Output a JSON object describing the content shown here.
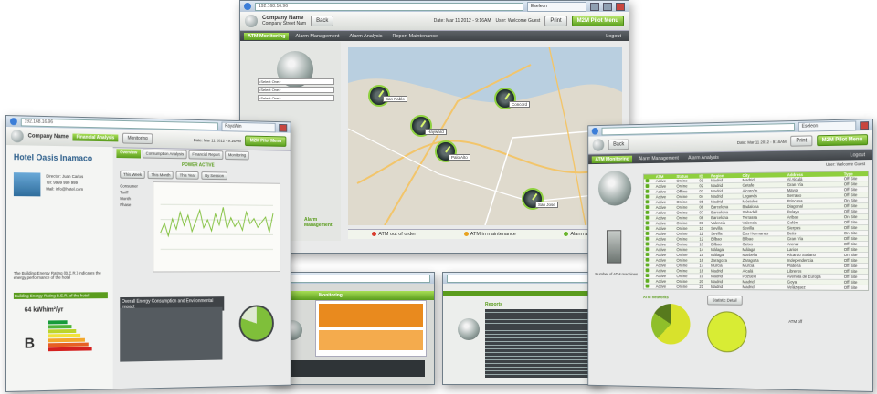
{
  "main_window": {
    "url": "192.168.16.96",
    "tab": "Eseleon",
    "brand_name": "Company Name",
    "brand_sub": "Company Street Nam",
    "back_label": "Back",
    "print_label": "Print",
    "pilot_label": "M2M Pilot Menu",
    "datetime": "Date: Mar 11 2012 - 9:16AM",
    "user": "User: Welcome Guest",
    "nav": [
      "ATM Monitoring",
      "Alarm Management",
      "Alarm Analysis",
      "Report Maintenance"
    ],
    "logout_label": "Logout",
    "selects": [
      "<Select One>",
      "<Select One>",
      "<Select One>"
    ],
    "side_title": "Alarm Management",
    "pins": [
      "San Pablo",
      "Concord",
      "Hayward",
      "Palo Alto",
      "San Jose"
    ],
    "legend": [
      {
        "label": "ATM out of order",
        "color": "#d93c2c"
      },
      {
        "label": "ATM in maintenance",
        "color": "#e8a21e"
      },
      {
        "label": "Alarm active",
        "color": "#6ab52b"
      }
    ]
  },
  "left_window": {
    "url": "192.168.16.96",
    "tab": "PayaWin",
    "brand_name": "Company Name",
    "date": "Date: Mar 11 2012 - 9:16AM",
    "user": "User: Welcome Guest",
    "nav": [
      "Financial Analysis",
      "Monitoring"
    ],
    "pilot_label": "M2M Pilot Menu",
    "hotel": "Hotel Oasis Inamaco",
    "tabs": [
      "Overview",
      "Consumption Analysis",
      "Financial Report",
      "Monitoring"
    ],
    "chart_title": "POWER ACTIVE",
    "periods": [
      "This Week",
      "This Month",
      "This Year",
      "By Session"
    ],
    "series": [
      "Consumer",
      "Tariff",
      "Month",
      "Phase"
    ],
    "info": [
      "Director: Juan Carlos",
      "Tel: 9999 999 999",
      "Mail: info@hotel.com"
    ],
    "rating_text": "The Building Energy Rating (B.E.R.) indicates the energy performance of the hotel",
    "rating_title": "Building Energy Rating B.E.R. of the hotel",
    "rating_value": "64 kWh/m²/yr",
    "rating_letter": "B",
    "bottom_title": "Overall Energy Consumption and Environmental Impact"
  },
  "right_window": {
    "tab": "Eseleon",
    "back_label": "Back",
    "print_label": "Print",
    "pilot_label": "M2M Pilot Menu",
    "datetime": "Date: Mar 11 2012 - 9:16AM",
    "user": "User: Welcome Guest",
    "logout_label": "Logout",
    "table_headers": [
      "",
      "ATM",
      "Status",
      "ID",
      "Region",
      "City",
      "Address",
      "Type"
    ],
    "rows": [
      [
        "Active",
        "Online",
        "01",
        "Madrid",
        "Madrid",
        "Al Alcalá",
        "Off Site"
      ],
      [
        "Active",
        "Online",
        "02",
        "Madrid",
        "Getafe",
        "Gran Vía",
        "Off Site"
      ],
      [
        "Active",
        "Offline",
        "03",
        "Madrid",
        "Alcorcón",
        "Mayor",
        "Off Site"
      ],
      [
        "Active",
        "Online",
        "04",
        "Madrid",
        "Leganés",
        "Serrano",
        "Off Site"
      ],
      [
        "Active",
        "Online",
        "05",
        "Madrid",
        "Móstoles",
        "Princesa",
        "On Site"
      ],
      [
        "Active",
        "Online",
        "06",
        "Barcelona",
        "Badalona",
        "Diagonal",
        "Off Site"
      ],
      [
        "Active",
        "Online",
        "07",
        "Barcelona",
        "Sabadell",
        "Pelayo",
        "Off Site"
      ],
      [
        "Active",
        "Online",
        "08",
        "Barcelona",
        "Terrassa",
        "Aribau",
        "On Site"
      ],
      [
        "Active",
        "Online",
        "09",
        "Valencia",
        "Valencia",
        "Colón",
        "Off Site"
      ],
      [
        "Active",
        "Online",
        "10",
        "Sevilla",
        "Sevilla",
        "Sierpes",
        "Off Site"
      ],
      [
        "Active",
        "Online",
        "11",
        "Sevilla",
        "Dos Hermanas",
        "Betis",
        "On Site"
      ],
      [
        "Active",
        "Online",
        "12",
        "Bilbao",
        "Bilbao",
        "Gran Vía",
        "Off Site"
      ],
      [
        "Active",
        "Online",
        "13",
        "Bilbao",
        "Getxo",
        "Arenal",
        "Off Site"
      ],
      [
        "Active",
        "Online",
        "14",
        "Málaga",
        "Málaga",
        "Larios",
        "Off Site"
      ],
      [
        "Active",
        "Online",
        "15",
        "Málaga",
        "Marbella",
        "Ricardo Soriano",
        "On Site"
      ],
      [
        "Active",
        "Online",
        "16",
        "Zaragoza",
        "Zaragoza",
        "Independencia",
        "Off Site"
      ],
      [
        "Active",
        "Online",
        "17",
        "Murcia",
        "Murcia",
        "Platería",
        "Off Site"
      ],
      [
        "Active",
        "Online",
        "18",
        "Madrid",
        "Alcalá",
        "Libreros",
        "Off Site"
      ],
      [
        "Active",
        "Online",
        "19",
        "Madrid",
        "Pozuelo",
        "Avenida de Europa",
        "Off Site"
      ],
      [
        "Active",
        "Online",
        "20",
        "Madrid",
        "Madrid",
        "Goya",
        "Off Site"
      ],
      [
        "Active",
        "Online",
        "21",
        "Madrid",
        "Madrid",
        "Velázquez",
        "Off Site"
      ],
      [
        "Active",
        "Online",
        "22",
        "Madrid",
        "Madrid",
        "Atocha",
        "Off Site"
      ]
    ],
    "side_label": "Number of ATM machines",
    "pie_label": "ATM networks",
    "sum_label": "Statistic Detail",
    "off_label": "ATM off"
  },
  "small_windows": {
    "center_left_title": "Monitoring",
    "center_right_title": "Reports"
  },
  "chart_data": {
    "type": "line",
    "title": "POWER ACTIVE",
    "series": [
      {
        "name": "Consumer",
        "values": [
          42,
          55,
          38,
          61,
          47,
          70,
          52,
          66,
          44,
          58,
          73,
          49,
          60,
          45,
          68,
          53,
          77,
          48,
          63,
          51,
          59,
          46,
          71,
          55,
          62,
          50,
          57,
          64,
          43,
          69
        ]
      }
    ],
    "ylim": [
      0,
      100
    ]
  }
}
